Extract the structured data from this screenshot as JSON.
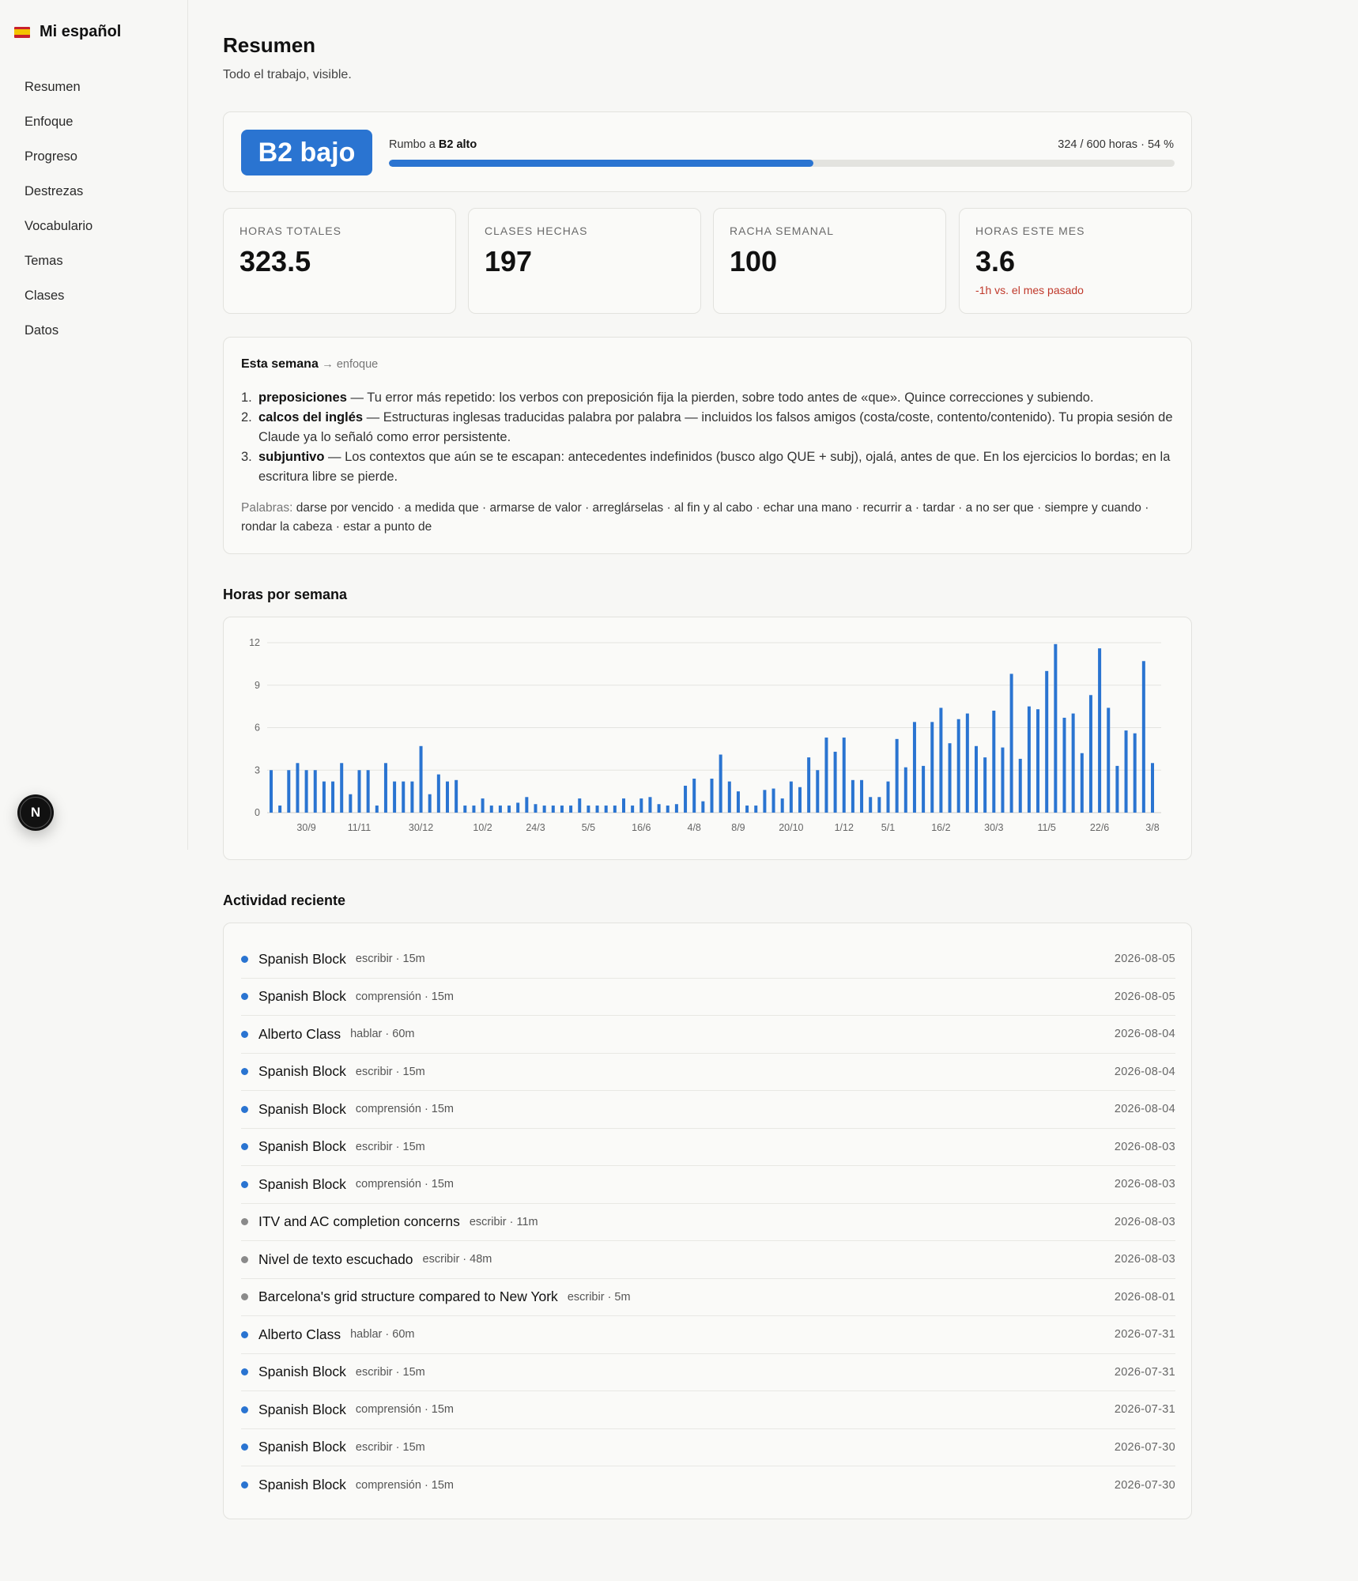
{
  "brand": {
    "name": "Mi español",
    "flag": "spain-flag-icon"
  },
  "nav": [
    "Resumen",
    "Enfoque",
    "Progreso",
    "Destrezas",
    "Vocabulario",
    "Temas",
    "Clases",
    "Datos"
  ],
  "fab": {
    "letter": "N"
  },
  "page": {
    "title": "Resumen",
    "subtitle": "Todo el trabajo, visible."
  },
  "level": {
    "badge": "B2 bajo",
    "toward_prefix": "Rumbo a",
    "toward_target": "B2 alto",
    "hours_text": "324 / 600 horas · 54 %",
    "progress": 0.54,
    "accent": "#2a74d1"
  },
  "stats": [
    {
      "label": "HORAS TOTALES",
      "value": "323.5"
    },
    {
      "label": "CLASES HECHAS",
      "value": "197"
    },
    {
      "label": "RACHA SEMANAL",
      "value": "100"
    },
    {
      "label": "HORAS ESTE MES",
      "value": "3.6",
      "delta": "-1h vs. el mes pasado"
    }
  ],
  "focus": {
    "title": "Esta semana",
    "link": "→ enfoque",
    "items": [
      {
        "num": "1.",
        "term": "preposiciones",
        "text": " — Tu error más repetido: los verbos con preposición fija la pierden, sobre todo antes de «que». Quince correcciones y subiendo."
      },
      {
        "num": "2.",
        "term": "calcos del inglés",
        "text": " — Estructuras inglesas traducidas palabra por palabra — incluidos los falsos amigos (costa/coste, contento/contenido). Tu propia sesión de Claude ya lo señaló como error persistente."
      },
      {
        "num": "3.",
        "term": "subjuntivo",
        "text": " — Los contextos que aún se te escapan: antecedentes indefinidos (busco algo QUE + subj), ojalá, antes de que. En los ejercicios lo bordas; en la escritura libre se pierde."
      }
    ],
    "words_label": "Palabras:",
    "words": "darse por vencido · a medida que · armarse de valor · arreglárselas · al fin y al cabo · echar una mano · recurrir a · tardar · a no ser que · siempre y cuando · rondar la cabeza · estar a punto de"
  },
  "chart_section_title": "Horas por semana",
  "chart_data": {
    "type": "bar",
    "title": "Horas por semana",
    "xlabel": "",
    "ylabel": "",
    "ylim": [
      0,
      12
    ],
    "yticks": [
      0,
      3,
      6,
      9,
      12
    ],
    "grid": true,
    "color": "#2a74d1",
    "xtick_labels": [
      {
        "index": 4,
        "label": "30/9"
      },
      {
        "index": 10,
        "label": "11/11"
      },
      {
        "index": 17,
        "label": "30/12"
      },
      {
        "index": 24,
        "label": "10/2"
      },
      {
        "index": 30,
        "label": "24/3"
      },
      {
        "index": 36,
        "label": "5/5"
      },
      {
        "index": 42,
        "label": "16/6"
      },
      {
        "index": 48,
        "label": "4/8"
      },
      {
        "index": 53,
        "label": "8/9"
      },
      {
        "index": 59,
        "label": "20/10"
      },
      {
        "index": 65,
        "label": "1/12"
      },
      {
        "index": 70,
        "label": "5/1"
      },
      {
        "index": 76,
        "label": "16/2"
      },
      {
        "index": 82,
        "label": "30/3"
      },
      {
        "index": 88,
        "label": "11/5"
      },
      {
        "index": 94,
        "label": "22/6"
      },
      {
        "index": 100,
        "label": "3/8"
      }
    ],
    "values": [
      3.0,
      0.5,
      3.0,
      3.5,
      3.0,
      3.0,
      2.2,
      2.2,
      3.5,
      1.3,
      3.0,
      3.0,
      0.5,
      3.5,
      2.2,
      2.2,
      2.2,
      4.7,
      1.3,
      2.7,
      2.2,
      2.3,
      0.5,
      0.5,
      1.0,
      0.5,
      0.5,
      0.5,
      0.7,
      1.1,
      0.6,
      0.5,
      0.5,
      0.5,
      0.5,
      1.0,
      0.5,
      0.5,
      0.5,
      0.5,
      1.0,
      0.5,
      1.0,
      1.1,
      0.6,
      0.5,
      0.6,
      1.9,
      2.4,
      0.8,
      2.4,
      4.1,
      2.2,
      1.5,
      0.5,
      0.5,
      1.6,
      1.7,
      1.0,
      2.2,
      1.8,
      3.9,
      3.0,
      5.3,
      4.3,
      5.3,
      2.3,
      2.3,
      1.1,
      1.1,
      2.2,
      5.2,
      3.2,
      6.4,
      3.3,
      6.4,
      7.4,
      4.9,
      6.6,
      7.0,
      4.7,
      3.9,
      7.2,
      4.6,
      9.8,
      3.8,
      7.5,
      7.3,
      10.0,
      11.9,
      6.7,
      7.0,
      4.2,
      8.3,
      11.6,
      7.4,
      3.3,
      5.8,
      5.6,
      10.7,
      3.5
    ]
  },
  "activity_section_title": "Actividad reciente",
  "activity": [
    {
      "title": "Spanish Block",
      "meta": "escribir · 15m",
      "date": "2026-08-05",
      "dot": "#2a74d1"
    },
    {
      "title": "Spanish Block",
      "meta": "comprensión · 15m",
      "date": "2026-08-05",
      "dot": "#2a74d1"
    },
    {
      "title": "Alberto Class",
      "meta": "hablar · 60m",
      "date": "2026-08-04",
      "dot": "#2a74d1"
    },
    {
      "title": "Spanish Block",
      "meta": "escribir · 15m",
      "date": "2026-08-04",
      "dot": "#2a74d1"
    },
    {
      "title": "Spanish Block",
      "meta": "comprensión · 15m",
      "date": "2026-08-04",
      "dot": "#2a74d1"
    },
    {
      "title": "Spanish Block",
      "meta": "escribir · 15m",
      "date": "2026-08-03",
      "dot": "#2a74d1"
    },
    {
      "title": "Spanish Block",
      "meta": "comprensión · 15m",
      "date": "2026-08-03",
      "dot": "#2a74d1"
    },
    {
      "title": "ITV and AC completion concerns",
      "meta": "escribir · 11m",
      "date": "2026-08-03",
      "dot": "#8a8a8a"
    },
    {
      "title": "Nivel de texto escuchado",
      "meta": "escribir · 48m",
      "date": "2026-08-03",
      "dot": "#8a8a8a"
    },
    {
      "title": "Barcelona's grid structure compared to New York",
      "meta": "escribir · 5m",
      "date": "2026-08-01",
      "dot": "#8a8a8a"
    },
    {
      "title": "Alberto Class",
      "meta": "hablar · 60m",
      "date": "2026-07-31",
      "dot": "#2a74d1"
    },
    {
      "title": "Spanish Block",
      "meta": "escribir · 15m",
      "date": "2026-07-31",
      "dot": "#2a74d1"
    },
    {
      "title": "Spanish Block",
      "meta": "comprensión · 15m",
      "date": "2026-07-31",
      "dot": "#2a74d1"
    },
    {
      "title": "Spanish Block",
      "meta": "escribir · 15m",
      "date": "2026-07-30",
      "dot": "#2a74d1"
    },
    {
      "title": "Spanish Block",
      "meta": "comprensión · 15m",
      "date": "2026-07-30",
      "dot": "#2a74d1"
    }
  ]
}
